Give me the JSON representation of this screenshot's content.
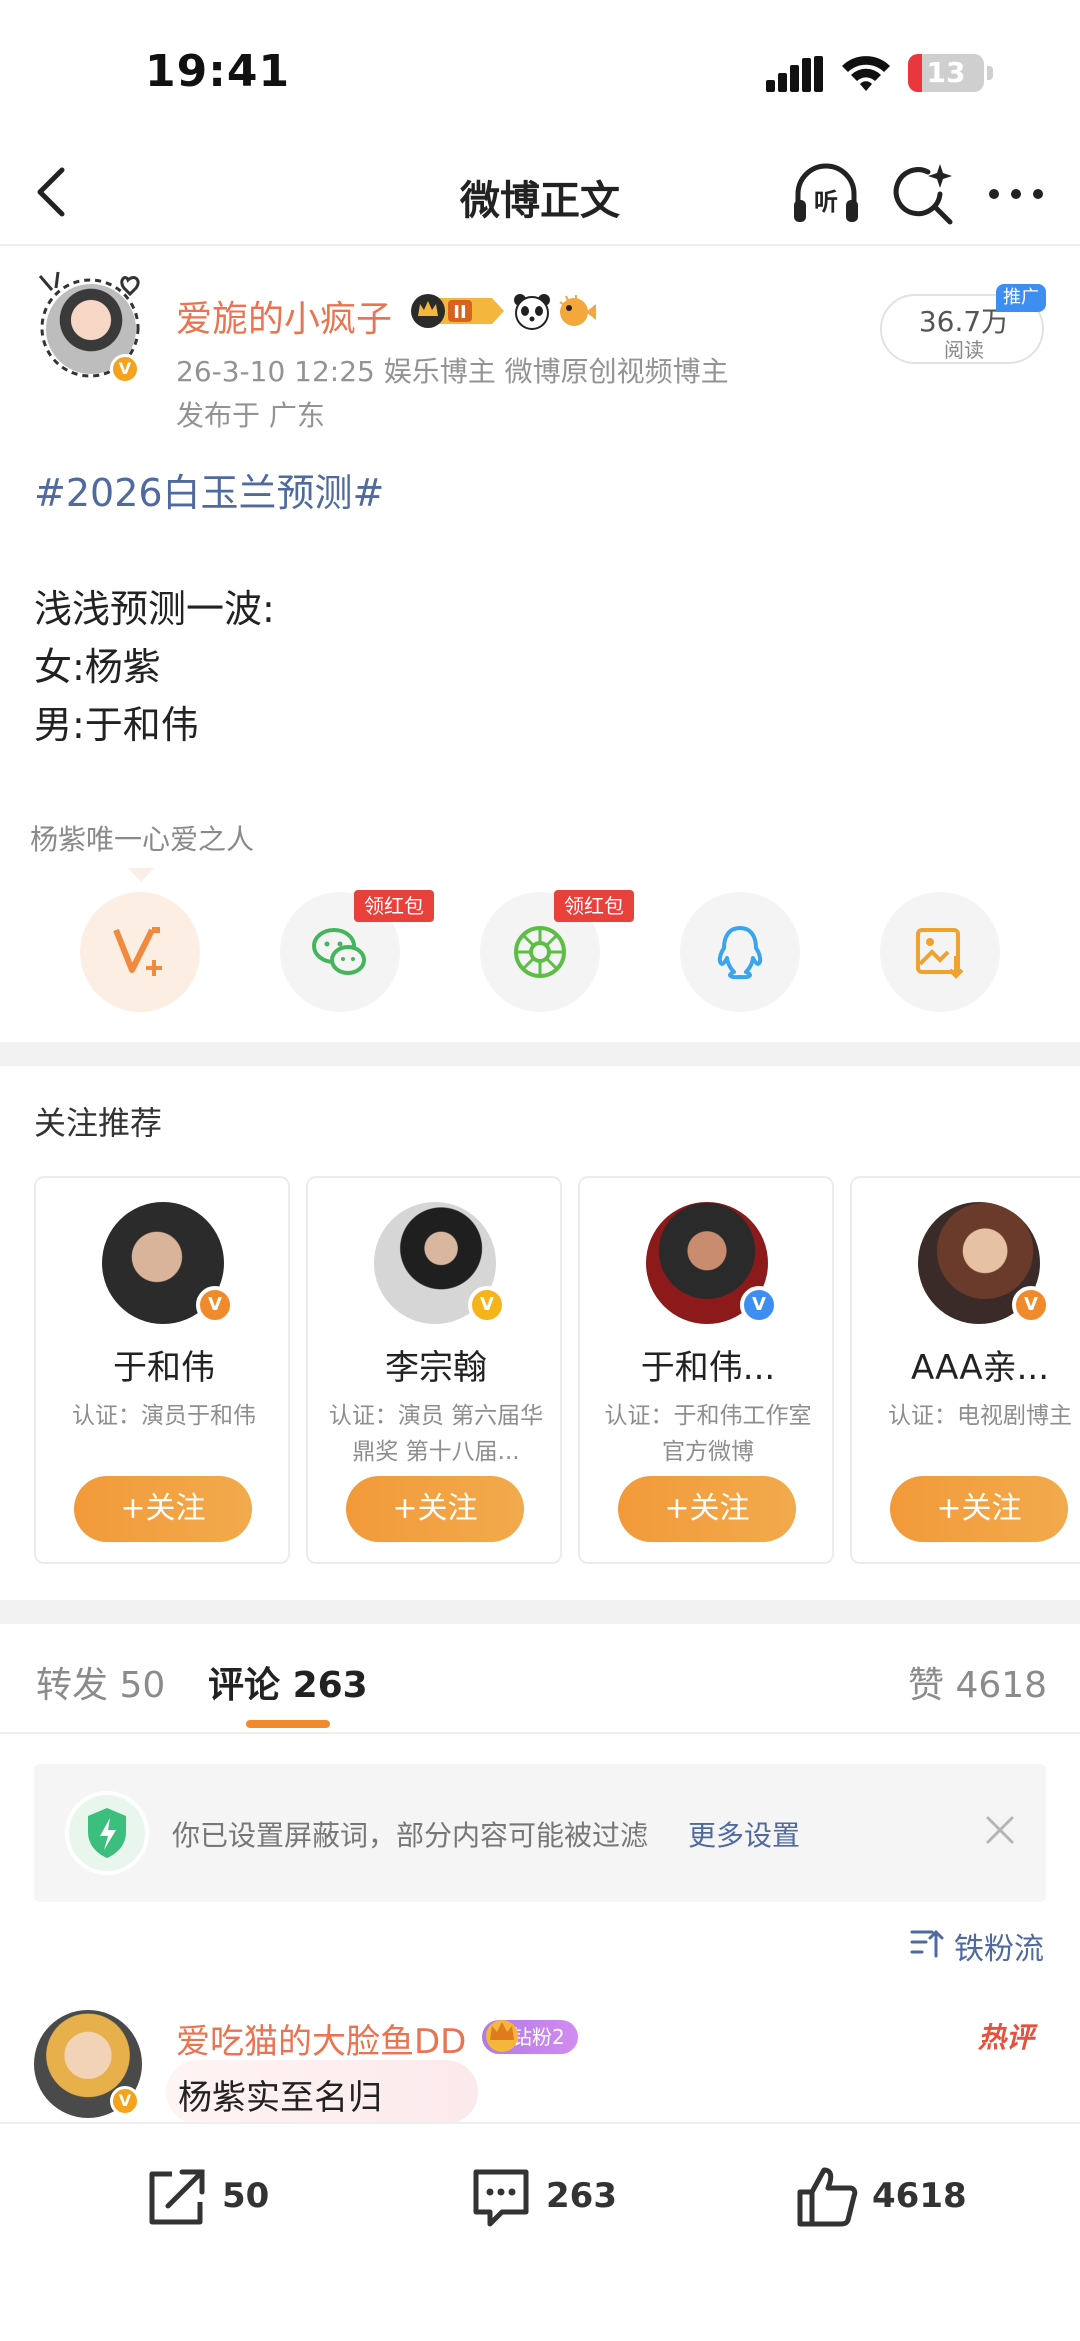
{
  "status_bar": {
    "time": "19:41",
    "battery": "13",
    "battery_level_percent": 13
  },
  "nav": {
    "title": "微博正文",
    "listen_label": "听"
  },
  "post": {
    "author": "爱旎的小疯子",
    "vip_level": "II",
    "meta": "26-3-10 12:25  娱乐博主 微博原创视频博主",
    "location": "发布于 广东",
    "reads_count": "36.7万",
    "reads_label": "阅读",
    "promo_tag": "推广",
    "topic": "#2026白玉兰预测#",
    "lines": [
      "浅浅预测一波:",
      "女:杨紫",
      "男:于和伟"
    ]
  },
  "share": {
    "tooltip": "杨紫唯一心爱之人",
    "hongbao_label": "领红包",
    "buttons": [
      "v-plus-icon",
      "wechat-icon",
      "moments-icon",
      "qq-icon",
      "save-image-icon"
    ]
  },
  "recommend": {
    "title": "关注推荐",
    "follow_label": "+关注",
    "cards": [
      {
        "name": "于和伟",
        "cert": "认证：演员于和伟"
      },
      {
        "name": "李宗翰",
        "cert": "认证：演员 第六届华鼎奖 第十八届..."
      },
      {
        "name": "于和伟...",
        "cert": "认证：于和伟工作室官方微博"
      },
      {
        "name": "AAA亲...",
        "cert": "认证：电视剧博主"
      }
    ]
  },
  "tabs": {
    "repost_label": "转发",
    "repost_count": "50",
    "comment_label": "评论",
    "comment_count": "263",
    "like_label": "赞",
    "like_count": "4618"
  },
  "notice": {
    "text": "你已设置屏蔽词，部分内容可能被过滤",
    "link": "更多设置"
  },
  "sort": {
    "label": "铁粉流"
  },
  "comment": {
    "author": "爱吃猫的大脸鱼DD",
    "badge": "钻粉2",
    "hot": "热评",
    "text": "杨紫实至名归"
  },
  "bottom_bar": {
    "repost": "50",
    "comment": "263",
    "like": "4618"
  },
  "colors": {
    "accent": "#eb7350",
    "link": "#506a9f",
    "follow": "#f29a3a",
    "hongbao": "#e8403a"
  }
}
